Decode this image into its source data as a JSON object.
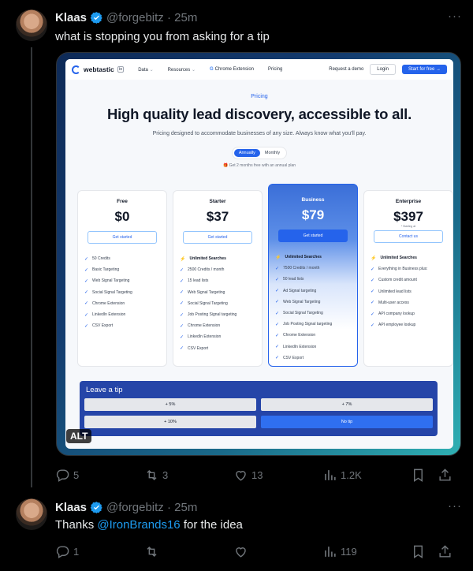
{
  "tweet1": {
    "name": "Klaas",
    "handle": "@forgebitz",
    "time": "25m",
    "text": "what is stopping you from asking for a tip",
    "more": "···",
    "alt_label": "ALT",
    "stats": {
      "replies": "5",
      "retweets": "3",
      "likes": "13",
      "views": "1.2K"
    }
  },
  "tweet2": {
    "name": "Klaas",
    "handle": "@forgebitz",
    "time": "25m",
    "text_before": "Thanks ",
    "mention": "@IronBrands16",
    "text_after": " for the idea",
    "more": "···",
    "stats": {
      "replies": "1",
      "retweets": "",
      "likes": "",
      "views": "119"
    }
  },
  "site": {
    "brand": "webtastic",
    "brand_tag": "io",
    "nav": [
      "Data",
      "Resources",
      "Chrome Extension",
      "Pricing"
    ],
    "request_demo": "Request a demo",
    "login": "Login",
    "start": "Start for free →",
    "eyebrow": "Pricing",
    "headline": "High quality lead discovery, accessible to all.",
    "subhead": "Pricing designed to accommodate businesses of any size. Always know what you'll pay.",
    "toggle": {
      "annually": "Annually",
      "monthly": "Monthly"
    },
    "note": "Get 2 months free with an annual plan",
    "plans": [
      {
        "name": "Free",
        "price": "$0",
        "starting": "",
        "cta": "Get started",
        "features": [
          "50 Credits",
          "Basic Targeting",
          "Web Signal Targeting",
          "Social Signal Targeting",
          "Chrome Extension",
          "LinkedIn Extension",
          "CSV Export"
        ]
      },
      {
        "name": "Starter",
        "price": "$37",
        "starting": "",
        "cta": "Get started",
        "highlight": "Unlimited Searches",
        "features": [
          "2500 Credits / month",
          "15 lead lists",
          "Web Signal Targeting",
          "Social Signal Targeting",
          "Job Posting Signal targeting",
          "Chrome Extension",
          "LinkedIn Extension",
          "CSV Export"
        ]
      },
      {
        "name": "Business",
        "price": "$79",
        "starting": "",
        "cta": "Get started",
        "highlight": "Unlimited Searches",
        "features": [
          "7500 Credits / month",
          "50 lead lists",
          "Ad Signal targeting",
          "Web Signal Targeting",
          "Social Signal Targeting",
          "Job Posting Signal targeting",
          "Chrome Extension",
          "LinkedIn Extension",
          "CSV Export"
        ]
      },
      {
        "name": "Enterprise",
        "price": "$397",
        "starting": "* Starting at",
        "cta": "Contact us",
        "highlight": "Unlimited Searches",
        "features": [
          "Everything in Business plus:",
          "Custom credit amount",
          "Unlimited lead lists",
          "Multi-user access",
          "API company lookup",
          "API employee lookup"
        ]
      }
    ],
    "tip": {
      "title": "Leave a tip",
      "options": [
        "+ 5%",
        "+ 7%",
        "+ 10%",
        "No tip"
      ]
    }
  }
}
